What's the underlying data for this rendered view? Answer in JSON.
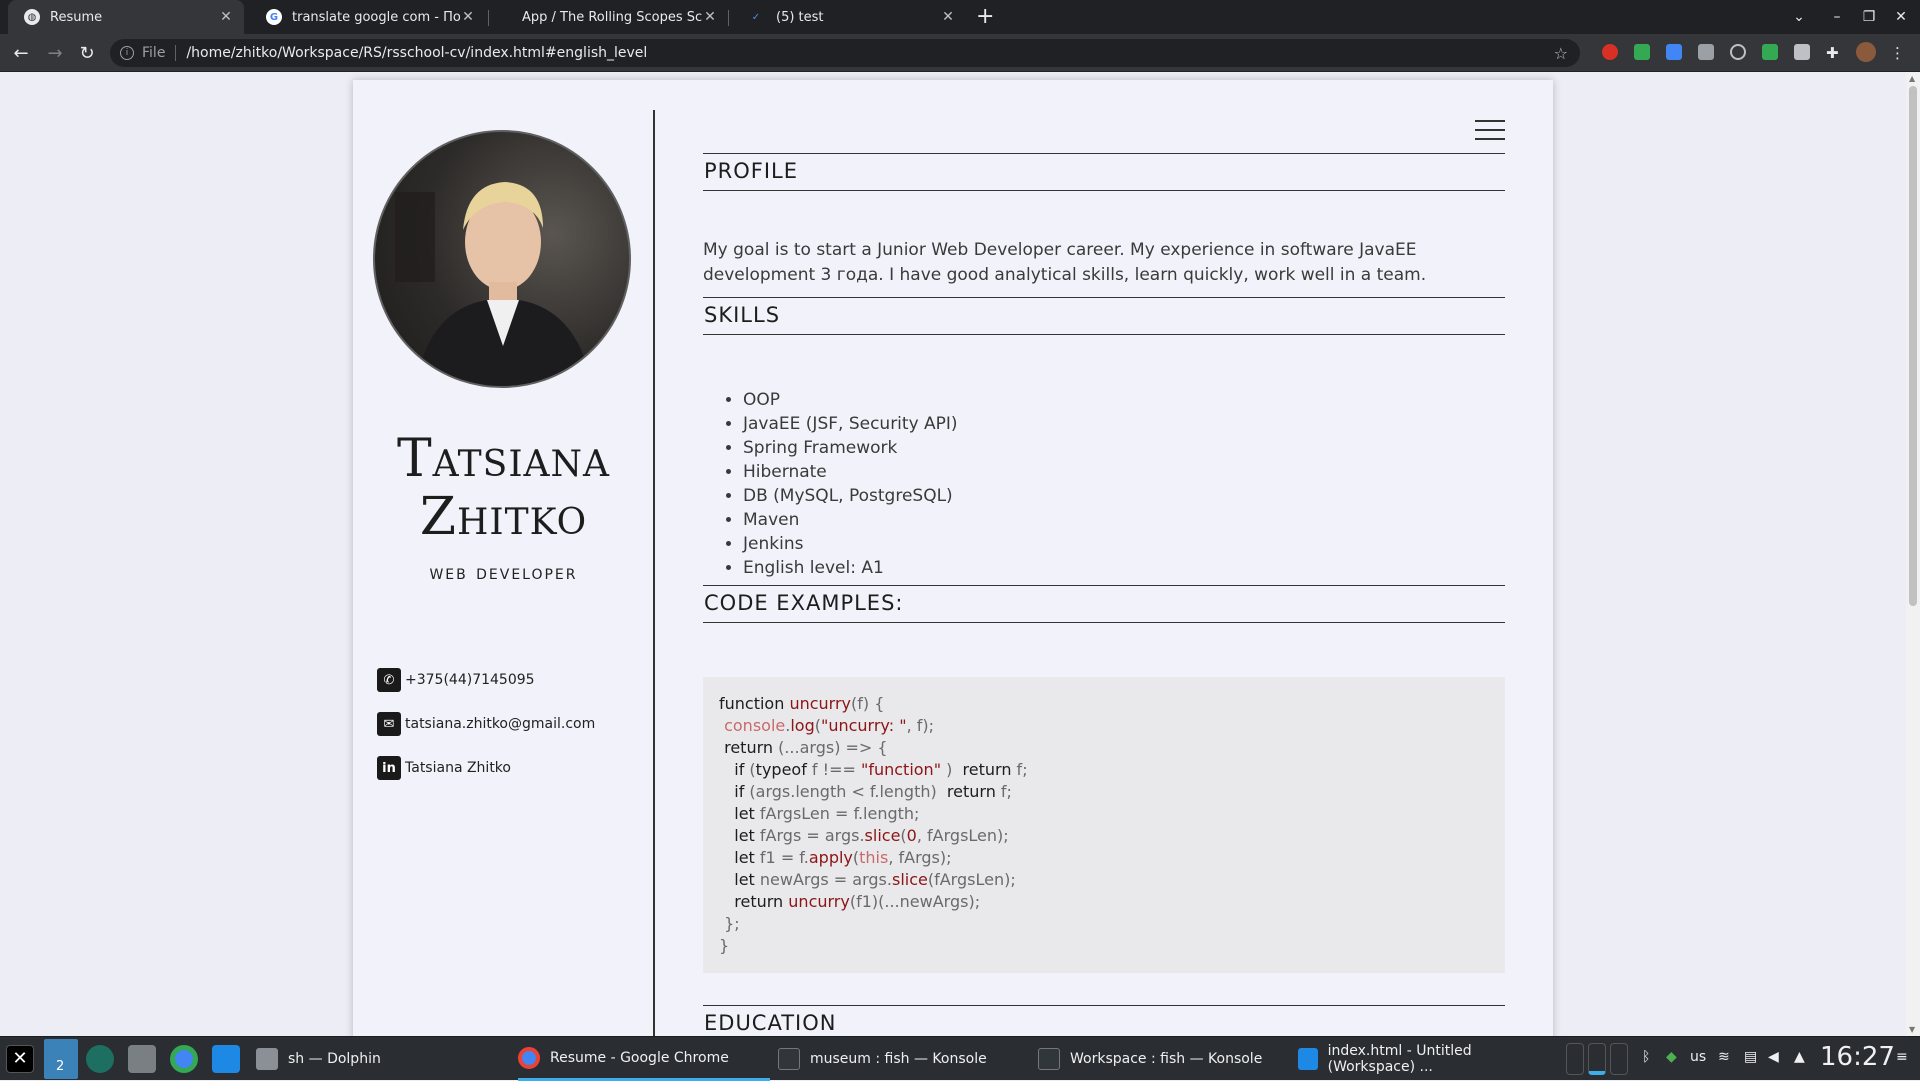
{
  "browser": {
    "tabs": [
      {
        "title": "Resume",
        "active": true
      },
      {
        "title": "translate google com - Поиск",
        "active": false
      },
      {
        "title": "App / The Rolling Scopes Sch",
        "active": false
      },
      {
        "title": "(5) test",
        "active": false
      }
    ],
    "address": {
      "scheme_label": "File",
      "url": "/home/zhitko/Workspace/RS/rsschool-cv/index.html#english_level"
    }
  },
  "resume": {
    "name_line1": "Tatsiana",
    "name_line2": "Zhitko",
    "role": "web developer",
    "contacts": {
      "phone": "+375(44)7145095",
      "email": "tatsiana.zhitko@gmail.com",
      "linkedin": "Tatsiana Zhitko"
    },
    "sections": {
      "profile": "PROFILE",
      "skills": "SKILLS",
      "code": "CODE EXAMPLES:",
      "education": "EDUCATION"
    },
    "profile_text": "My goal is to start a Junior Web Developer career. My experience in software JavaEE development 3 года. I have good analytical skills, learn quickly, work well in a team.",
    "skills": [
      "OOP",
      "JavaEE (JSF, Security API)",
      "Spring Framework",
      "Hibernate",
      "DB (MySQL, PostgreSQL)",
      "Maven",
      "Jenkins",
      "English level: A1"
    ]
  },
  "taskbar": {
    "desktop_num": "2",
    "tasks": [
      "sh — Dolphin",
      "Resume - Google Chrome",
      "museum : fish — Konsole",
      "Workspace : fish — Konsole",
      "index.html - Untitled (Workspace) ..."
    ],
    "keyboard_layout": "us",
    "clock": "16:27"
  },
  "colors": {
    "accent": "#3daee9",
    "code_keyword_red": "#8c1515"
  }
}
